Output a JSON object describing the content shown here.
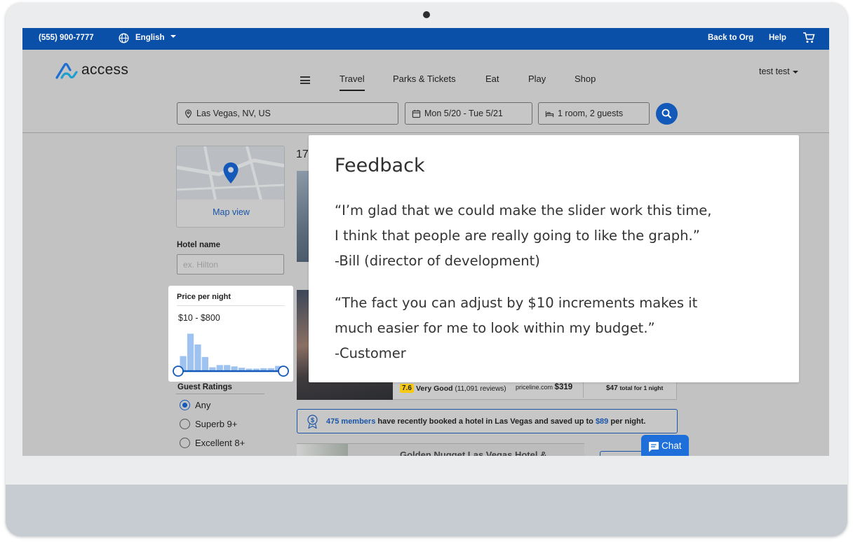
{
  "topbar": {
    "phone": "(555) 900-7777",
    "language": "English",
    "back_to_org": "Back to Org",
    "help": "Help",
    "cart_icon": "cart-icon"
  },
  "header": {
    "logo_text": "access",
    "nav": [
      "Travel",
      "Parks & Tickets",
      "Eat",
      "Play",
      "Shop"
    ],
    "active_nav": "Travel",
    "user": "test test"
  },
  "search": {
    "location": "Las Vegas, NV, US",
    "dates": "Mon 5/20 - Tue 5/21",
    "guests": "1 room, 2 guests"
  },
  "sidebar": {
    "map_link": "Map view",
    "hotel_name_label": "Hotel name",
    "hotel_name_placeholder": "ex. Hilton",
    "price": {
      "label": "Price per night",
      "range": "$10 - $800",
      "min_value": 10,
      "max_value": 800,
      "histogram": [
        0.32,
        0.82,
        0.58,
        0.3,
        0.07,
        0.12,
        0.12,
        0.09,
        0.06,
        0.04,
        0.04,
        0.05,
        0.05,
        0.1
      ]
    },
    "guest_ratings_label": "Guest Ratings",
    "ratings": [
      {
        "label": "Any",
        "selected": true
      },
      {
        "label": "Superb 9+",
        "selected": false
      },
      {
        "label": "Excellent 8+",
        "selected": false
      }
    ]
  },
  "results": {
    "count_fragment": "17",
    "card": {
      "rating": "7.6",
      "rating_text": "Very Good",
      "reviews": "(11,091 reviews)",
      "source": "priceline.com",
      "source_price": "$319",
      "total_price": "$47",
      "total_label": "total for 1 night"
    },
    "promo": {
      "members": "475 members",
      "text_mid": " have recently booked a hotel in Las Vegas and saved up to ",
      "amount": "$89",
      "text_end": " per night."
    },
    "next_hotel_title": "Golden Nugget Las Vegas Hotel &"
  },
  "chat": {
    "label": "Chat"
  },
  "feedback": {
    "title": "Feedback",
    "quote1": [
      "“I’m glad that we could make the slider work this time,",
      "I think that people are really going to like the graph.”",
      "-Bill (director of development)"
    ],
    "quote2": [
      "“The fact you can adjust by $10 increments makes it",
      "much easier for me to look within my budget.”",
      "-Customer"
    ]
  },
  "colors": {
    "brand_blue": "#0a4fa8",
    "link_blue": "#1a55a8",
    "histogram_bar": "#9fc3f1",
    "slider_blue": "#1259b9",
    "rating_yellow": "#f6c915"
  }
}
